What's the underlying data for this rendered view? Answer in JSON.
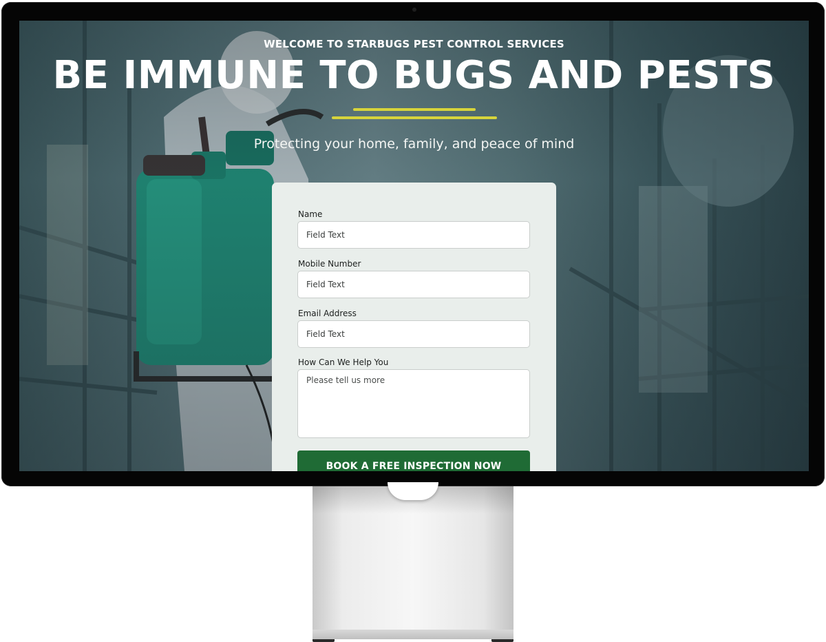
{
  "hero": {
    "eyebrow": "WELCOME TO STARBUGS PEST CONTROL SERVICES",
    "headline": "BE IMMUNE TO BUGS AND PESTS",
    "subtitle": "Protecting your home, family, and peace of mind"
  },
  "form": {
    "name_label": "Name",
    "name_placeholder": "Field Text",
    "mobile_label": "Mobile Number",
    "mobile_placeholder": "Field Text",
    "email_label": "Email Address",
    "email_placeholder": "Field Text",
    "help_label": "How Can We Help You",
    "help_placeholder": "Please tell us more",
    "submit_label": "BOOK A FREE INSPECTION NOW"
  },
  "colors": {
    "accent_rule": "#d7d43b",
    "cta_green": "#1f6b35",
    "card_bg": "#e9eeeb"
  }
}
